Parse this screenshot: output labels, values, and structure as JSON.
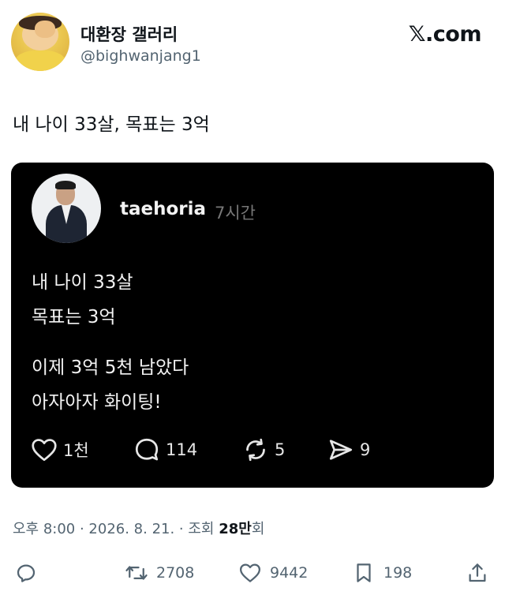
{
  "author": {
    "display_name": "대환장 갤러리",
    "handle": "@bighwanjang1"
  },
  "brand": {
    "logo_text": "𝕏.com"
  },
  "tweet": {
    "text": "내 나이 33살, 목표는 3억"
  },
  "embedded_post": {
    "username": "taehoria",
    "time": "7시간",
    "lines": [
      "내 나이 33살",
      "목표는 3억",
      "이제 3억 5천 남았다",
      "아자아자 화이팅!"
    ],
    "actions": {
      "likes": "1천",
      "comments": "114",
      "reposts": "5",
      "shares": "9"
    }
  },
  "meta": {
    "prefix": "오후 8:00 · 2026. 8. 21. · 조회 ",
    "views": "28만",
    "suffix": "회"
  },
  "stats": {
    "retweets": "2708",
    "likes": "9442",
    "bookmarks": "198"
  },
  "icons": [
    "reply-icon",
    "retweet-icon",
    "heart-icon",
    "bookmark-icon",
    "share-icon",
    "comment-bubble-icon",
    "repost-icon",
    "send-icon"
  ],
  "colors": {
    "secondary_text": "#536471",
    "card_bg": "#000000"
  }
}
